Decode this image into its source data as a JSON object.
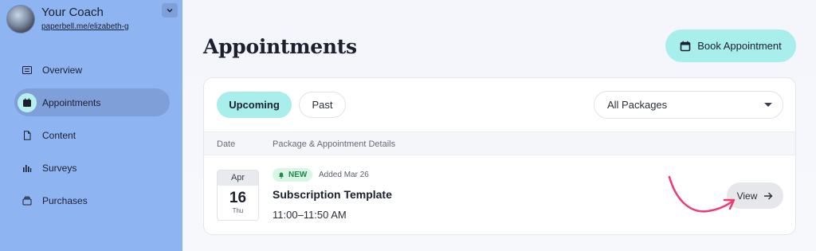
{
  "sidebar": {
    "coach_name": "Your Coach",
    "coach_link": "paperbell.me/elizabeth-g",
    "items": [
      {
        "label": "Overview",
        "icon": "overview-icon"
      },
      {
        "label": "Appointments",
        "icon": "calendar-icon",
        "active": true
      },
      {
        "label": "Content",
        "icon": "document-icon"
      },
      {
        "label": "Surveys",
        "icon": "bar-chart-icon"
      },
      {
        "label": "Purchases",
        "icon": "purchases-icon"
      }
    ]
  },
  "main": {
    "title": "Appointments",
    "book_button": "Book Appointment",
    "tabs": [
      {
        "label": "Upcoming",
        "active": true
      },
      {
        "label": "Past",
        "active": false
      }
    ],
    "filter": {
      "selected": "All Packages"
    },
    "table": {
      "headers": [
        "Date",
        "Package & Appointment Details"
      ],
      "rows": [
        {
          "month": "Apr",
          "day": "16",
          "weekday": "Thu",
          "badge": "NEW",
          "added": "Added Mar 26",
          "title": "Subscription Template",
          "time": "11:00–11:50 AM",
          "action": "View"
        }
      ]
    }
  },
  "colors": {
    "sidebar_bg": "#8fb4f2",
    "accent": "#a8eeea",
    "annotation_arrow": "#ef3b74"
  }
}
